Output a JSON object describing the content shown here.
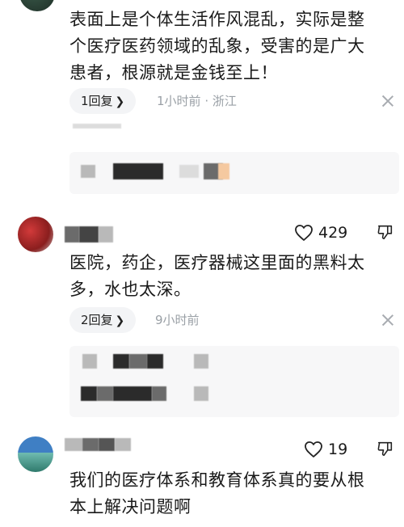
{
  "comments": [
    {
      "text_lines": [
        "表面上是个体生活作风混乱，实际是整",
        "个医疗医药领域的乱象，受害的是广大",
        "患者，根源就是金钱至上！"
      ],
      "reply_label": "1回复",
      "time": "1小时前",
      "location": "浙江"
    },
    {
      "likes": "429",
      "text_lines": [
        "医院，药企，医疗器械这里面的黑料太",
        "多，水也太深。"
      ],
      "reply_label": "2回复",
      "time": "9小时前"
    },
    {
      "likes": "19",
      "text_lines": [
        "我们的医疗体系和教育体系真的要从根",
        "本上解决问题啊"
      ]
    }
  ],
  "icons": [
    "chevron-right-icon",
    "close-icon",
    "heart-icon",
    "dislike-icon"
  ]
}
